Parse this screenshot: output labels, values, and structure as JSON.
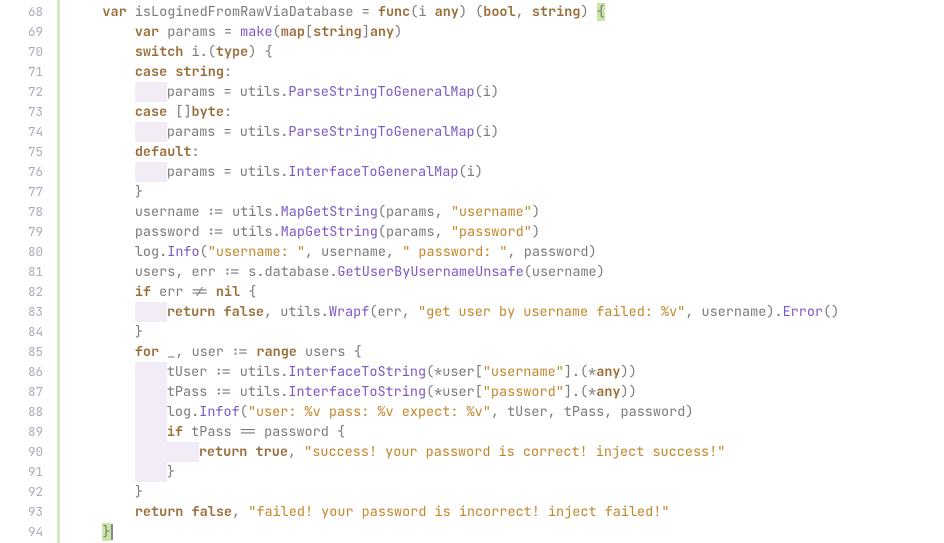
{
  "editor": {
    "first_line": 68,
    "last_line": 94,
    "lines": [
      "    var isLoginedFromRawViaDatabase = func(i any) (bool, string) {",
      "        var params = make(map[string]any)",
      "        switch i.(type) {",
      "        case string:",
      "            params = utils.ParseStringToGeneralMap(i)",
      "        case []byte:",
      "            params = utils.ParseStringToGeneralMap(i)",
      "        default:",
      "            params = utils.InterfaceToGeneralMap(i)",
      "        }",
      "        username := utils.MapGetString(params, \"username\")",
      "        password := utils.MapGetString(params, \"password\")",
      "        log.Info(\"username: \", username, \" password: \", password)",
      "        users, err := s.database.GetUserByUsernameUnsafe(username)",
      "        if err != nil {",
      "            return false, utils.Wrapf(err, \"get user by username failed: %v\", username).Error()",
      "        }",
      "        for _, user := range users {",
      "            tUser := utils.InterfaceToString(*user[\"username\"].(*any))",
      "            tPass := utils.InterfaceToString(*user[\"password\"].(*any))",
      "            log.Infof(\"user: %v pass: %v expect: %v\", tUser, tPass, password)",
      "            if tPass == password {",
      "                return true, \"success! your password is correct! inject success!\"",
      "            }",
      "        }",
      "        return false, \"failed! your password is incorrect! inject failed!\"",
      "    }"
    ]
  }
}
